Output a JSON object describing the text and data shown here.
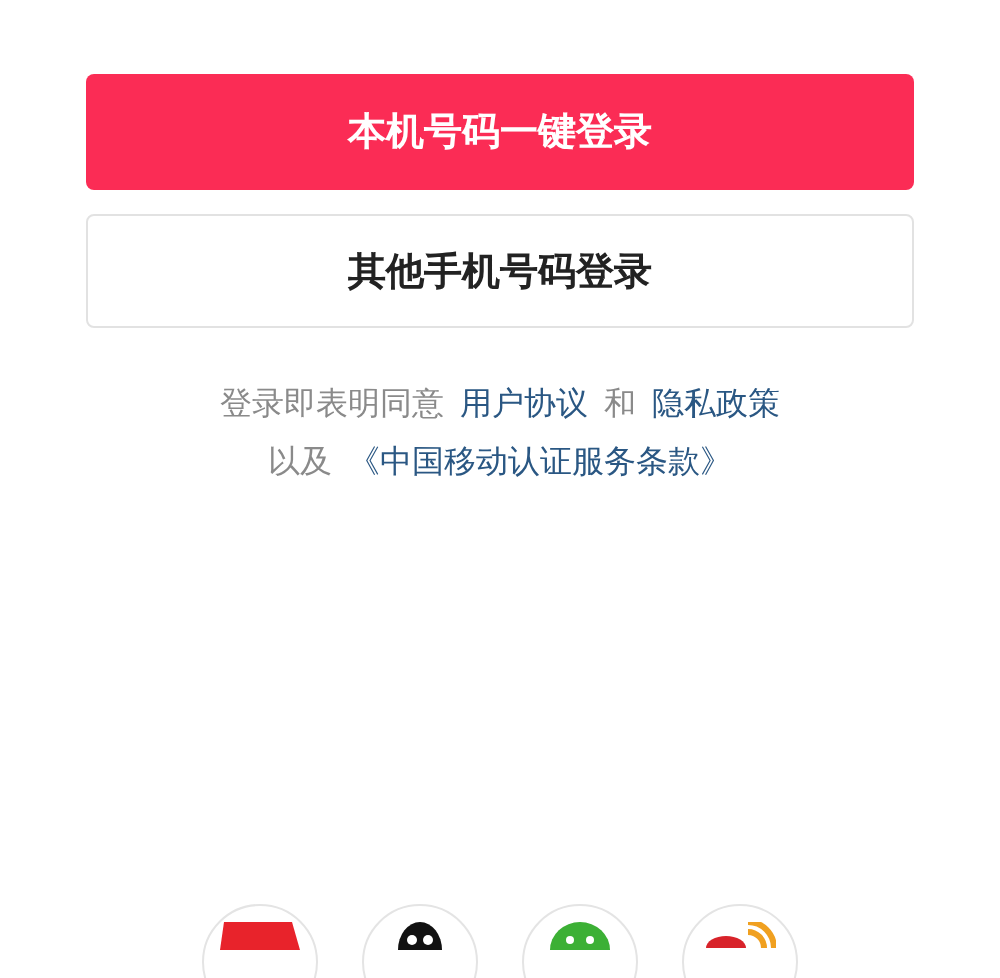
{
  "buttons": [
    {
      "label": "本机号码一键登录",
      "kind": "primary"
    },
    {
      "label": "其他手机号码登录",
      "kind": "secondary"
    }
  ],
  "agreement": [
    [
      {
        "text": "登录即表明同意",
        "kind": "text"
      },
      {
        "text": "用户协议",
        "kind": "link"
      },
      {
        "text": "和",
        "kind": "text"
      },
      {
        "text": "隐私政策",
        "kind": "link"
      }
    ],
    [
      {
        "text": "以及",
        "kind": "text"
      },
      {
        "text": "《中国移动认证服务条款》",
        "kind": "link"
      }
    ]
  ],
  "social_logins": [
    {
      "kind": "red-badge"
    },
    {
      "kind": "penguin"
    },
    {
      "kind": "green-bubble"
    },
    {
      "kind": "signal"
    }
  ]
}
